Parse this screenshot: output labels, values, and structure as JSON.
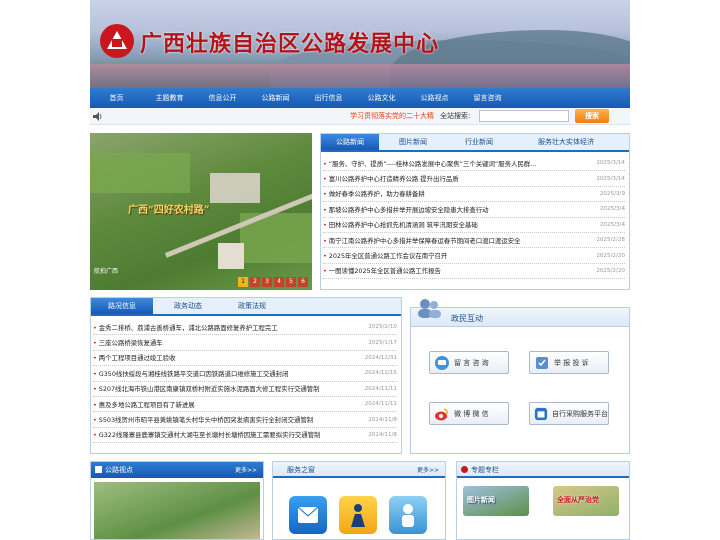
{
  "site": {
    "title": "广西壮族自治区公路发展中心"
  },
  "nav": [
    "首页",
    "主题教育",
    "信息公开",
    "公路新闻",
    "出行信息",
    "公路文化",
    "公路视点",
    "留言咨询"
  ],
  "subbar": {
    "marquee": "学习贯彻落实党的二十大精",
    "search_label": "全站搜索:",
    "search_value": "",
    "search_button": "搜索"
  },
  "hero": {
    "slogan": "广西“四好农村路”",
    "caption": "航拍广西",
    "pages": [
      "1",
      "2",
      "3",
      "4",
      "5",
      "6"
    ],
    "active_page": 1
  },
  "news": {
    "tabs": [
      "公路新闻",
      "图片新闻",
      "行业新闻",
      "服务壮大实体经济"
    ],
    "active_tab": 0,
    "items": [
      {
        "title": "“服务、守护、提质”----桂林公路发展中心聚焦“三个关键词”服务人民群...",
        "date": "2025/3/14"
      },
      {
        "title": "富川公路养护中心打造精养公路 提升出行品质",
        "date": "2025/3/14"
      },
      {
        "title": "做好春季公路养护，助力春耕备耕",
        "date": "2025/3/9"
      },
      {
        "title": "那坡公路养护中心多措并举开展边坡安全隐患大排查行动",
        "date": "2025/3/4"
      },
      {
        "title": "田林公路养护中心抢抓先机清涵洞 筑牢汛期安全基础",
        "date": "2025/3/4"
      },
      {
        "title": "南宁江南公路养护中心多措并举保障春运春节期间老口渡口渡运安全",
        "date": "2025/2/28"
      },
      {
        "title": "2025年全区普通公路工作会议在南宁召开",
        "date": "2025/2/20"
      },
      {
        "title": "一图读懂2025年全区普通公路工作报告",
        "date": "2025/2/20"
      }
    ]
  },
  "traffic": {
    "tabs": [
      "路况信息",
      "政务动态",
      "政策法规"
    ],
    "active_tab": 0,
    "items": [
      {
        "title": "金秀二排桥、荔浦古善桥通车，浦北公路路面修复养护工程完工",
        "date": "2025/2/10"
      },
      {
        "title": "三座公路桥梁恢复通车",
        "date": "2025/1/17"
      },
      {
        "title": "两个工程项目通过竣工验收",
        "date": "2024/12/31"
      },
      {
        "title": "G350线扶绥段与湘桂线铁路平交道口因铁路道口维修施工交通封闭",
        "date": "2024/12/15"
      },
      {
        "title": "S207线北海市铁山港区南康镇双桥村附近实施水泥路面大修工程实行交通管制",
        "date": "2024/11/11"
      },
      {
        "title": "惠及多地公路工程项目有了新进展",
        "date": "2024/11/11"
      },
      {
        "title": "S503线贺州市昭平县黄姚镇笔头村华头中桥因突发病害实行全封闭交通管制",
        "date": "2024/11/8"
      },
      {
        "title": "G322线隆寨县鹿寨镇交通村大湖屯至长塘村长塘桥因施工需要拟实行交通管制",
        "date": "2024/11/8"
      }
    ]
  },
  "gov": {
    "title": "政民互动",
    "buttons": [
      "留 言 咨 询",
      "举 报 投 诉",
      "微 博 微 信",
      "自行采购服务平台"
    ]
  },
  "bottom": {
    "road_view": {
      "title": "公路视点",
      "more": "更多>>"
    },
    "service": {
      "title": "服务之窗",
      "more": "更多>>"
    },
    "special": {
      "title": "专题专栏",
      "items": [
        "图片新闻",
        "全面从严治党"
      ]
    }
  },
  "colors": {
    "brand_red": "#c8171d",
    "nav_blue": "#1659b3",
    "accent_orange": "#f37d12"
  }
}
